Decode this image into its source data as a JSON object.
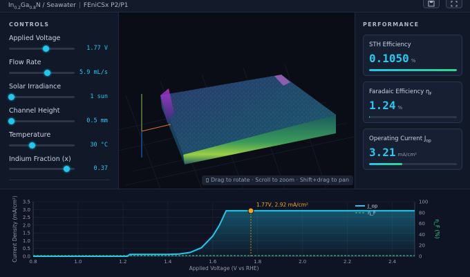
{
  "header": {
    "title_prefix": "In",
    "title_sub1": "0.2",
    "title_mid": "Ga",
    "title_sub2": "0.8",
    "title_suffix": "N / Seawater",
    "separator": "|",
    "title_right": "FEniCSx P2/P1",
    "icons": [
      "save-icon",
      "expand-icon"
    ]
  },
  "controls": {
    "title": "CONTROLS",
    "items": [
      {
        "label": "Applied Voltage",
        "value": "1.77 V",
        "fraction": 0.56
      },
      {
        "label": "Flow Rate",
        "value": "5.9 mL/s",
        "fraction": 0.58
      },
      {
        "label": "Solar Irradiance",
        "value": "1 sun",
        "fraction": 0.04
      },
      {
        "label": "Channel Height",
        "value": "0.5 mm",
        "fraction": 0.04
      },
      {
        "label": "Temperature",
        "value": "30 °C",
        "fraction": 0.35
      },
      {
        "label": "Indium Fraction (x)",
        "value": "0.37",
        "fraction": 0.88
      }
    ]
  },
  "viewer": {
    "hint_icon": "mouse-icon",
    "hint": "Drag to rotate · Scroll to zoom · Shift+drag to pan"
  },
  "performance": {
    "title": "PERFORMANCE",
    "cards": [
      {
        "label": "STH Efficiency",
        "value": "0.1050",
        "unit": "%",
        "fraction": 1.0
      },
      {
        "label_main": "Faradaic Efficiency η",
        "label_sub": "F",
        "value": "1.24",
        "unit": "%",
        "fraction": 0.01
      },
      {
        "label_main": "Operating Current J",
        "label_sub": "op",
        "value": "3.21",
        "unit": "mA/cm²",
        "fraction": 0.38
      }
    ]
  },
  "colors": {
    "accent": "#22c7ee",
    "green": "#2bd98a",
    "marker": "#f5a524"
  },
  "chart_data": {
    "type": "line",
    "xlabel": "Applied Voltage (V vs RHE)",
    "ylabel": "Current Density (mA/cm²)",
    "y2label": "η_F (%)",
    "xlim": [
      0.8,
      2.5
    ],
    "ylim": [
      0,
      3.5
    ],
    "y2lim": [
      0,
      100
    ],
    "xticks": [
      "0.8",
      "1.0",
      "1.2",
      "1.4",
      "1.6",
      "1.8",
      "2.0",
      "2.2",
      "2.4"
    ],
    "yticks": [
      "0.0",
      "0.5",
      "1.0",
      "1.5",
      "2.0",
      "2.5",
      "3.0",
      "3.5"
    ],
    "y2ticks": [
      "0",
      "20",
      "40",
      "60",
      "80",
      "100"
    ],
    "series": [
      {
        "name": "J_op",
        "color": "#22c7ee",
        "x": [
          0.8,
          1.22,
          1.23,
          1.3,
          1.4,
          1.45,
          1.5,
          1.55,
          1.6,
          1.63,
          1.66,
          1.7,
          1.8,
          2.0,
          2.2,
          2.4,
          2.5
        ],
        "y": [
          0.0,
          0.0,
          0.12,
          0.12,
          0.12,
          0.14,
          0.25,
          0.55,
          1.3,
          2.0,
          2.92,
          2.92,
          2.92,
          2.92,
          2.92,
          2.92,
          2.92
        ]
      },
      {
        "name": "η_F",
        "axis": "y2",
        "color": "#2bd98a",
        "x": [
          0.8,
          2.5
        ],
        "y": [
          0,
          0
        ]
      }
    ],
    "marker": {
      "x": 1.77,
      "y": 2.92,
      "label": "1.77V, 2.92 mA/cm²"
    },
    "legend": "top-right"
  }
}
